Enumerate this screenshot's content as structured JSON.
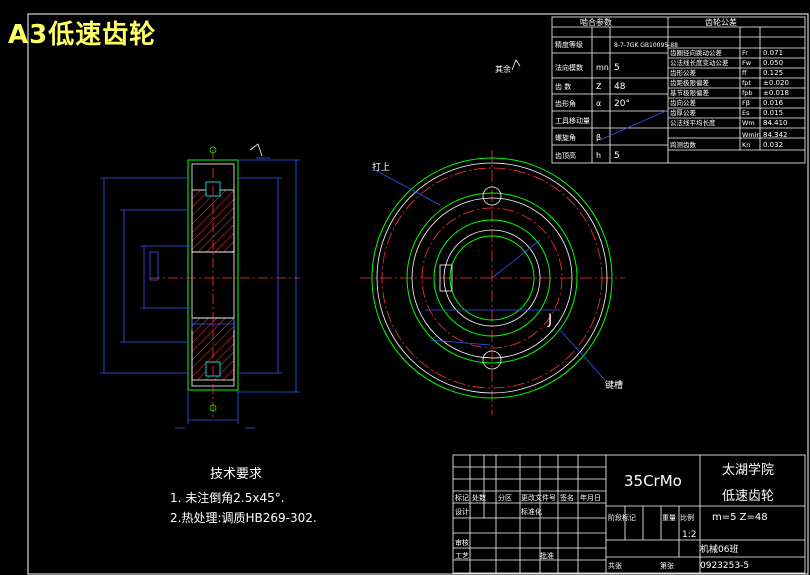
{
  "title": "A3低速齿轮",
  "params_table": {
    "headers": [
      "啮合参数",
      "齿轮公差"
    ],
    "rows": [
      {
        "name": "精度等级",
        "sym": "",
        "value": "8-7-7GK GB10095-88"
      },
      {
        "name": "法向模数",
        "sym": "mn",
        "value": "5"
      },
      {
        "name": "齿  数",
        "sym": "Z",
        "value": "48"
      },
      {
        "name": "齿形角",
        "sym": "α",
        "value": "20°"
      },
      {
        "name": "工具移动量",
        "sym": "",
        "value": ""
      },
      {
        "name": "螺旋角",
        "sym": "β",
        "value": ""
      },
      {
        "name": "齿顶高",
        "sym": "h",
        "value": "5"
      }
    ],
    "tol_rows": [
      {
        "name": "齿圈径向跳动公差",
        "sym": "Fr",
        "value": "0.071"
      },
      {
        "name": "公法线长度变动公差",
        "sym": "Fw",
        "value": "0.050"
      },
      {
        "name": "齿形公差",
        "sym": "ff",
        "value": "0.125"
      },
      {
        "name": "齿距极限偏差",
        "sym": "fpt",
        "value": "±0.020"
      },
      {
        "name": "基节极限偏差",
        "sym": "fpb",
        "value": "±0.018"
      },
      {
        "name": "齿向公差",
        "sym": "Fβ",
        "value": "0.016"
      },
      {
        "name": "齿厚公差",
        "sym": "Es",
        "value": "0.015"
      },
      {
        "name": "公法线平均长度",
        "sym": "Wm",
        "value": "84.410"
      },
      {
        "name": "",
        "sym": "Wmin",
        "value": "84.342"
      },
      {
        "name": "跨测齿数",
        "sym": "Kn",
        "value": "0.032"
      }
    ]
  },
  "annotations": {
    "surface_finish": "其余",
    "hub_label": "打上",
    "pointer_label": "键槽",
    "note_j": "J"
  },
  "tech_req": {
    "heading": "技术要求",
    "items": [
      "1. 未注倒角2.5x45°.",
      "2.热处理:调质HB269-302."
    ]
  },
  "title_block": {
    "material": "35CrMo",
    "school": "太湖学院",
    "part_name": "低速齿轮",
    "part_spec": "m=5  Z=48",
    "scale": "1:2",
    "drawing_type": "机械06班",
    "drawing_no": "0923253-5",
    "row_labels": [
      "标记",
      "处数",
      "分区",
      "更改文件号",
      "签名",
      "年月日"
    ],
    "design_labels": [
      "设计",
      "标准化"
    ],
    "stage_labels": [
      "阶段标记",
      "重量",
      "比例"
    ],
    "review_labels": [
      "审核",
      "工艺",
      "批准"
    ],
    "sheet_labels": [
      "共张",
      "第张"
    ]
  }
}
